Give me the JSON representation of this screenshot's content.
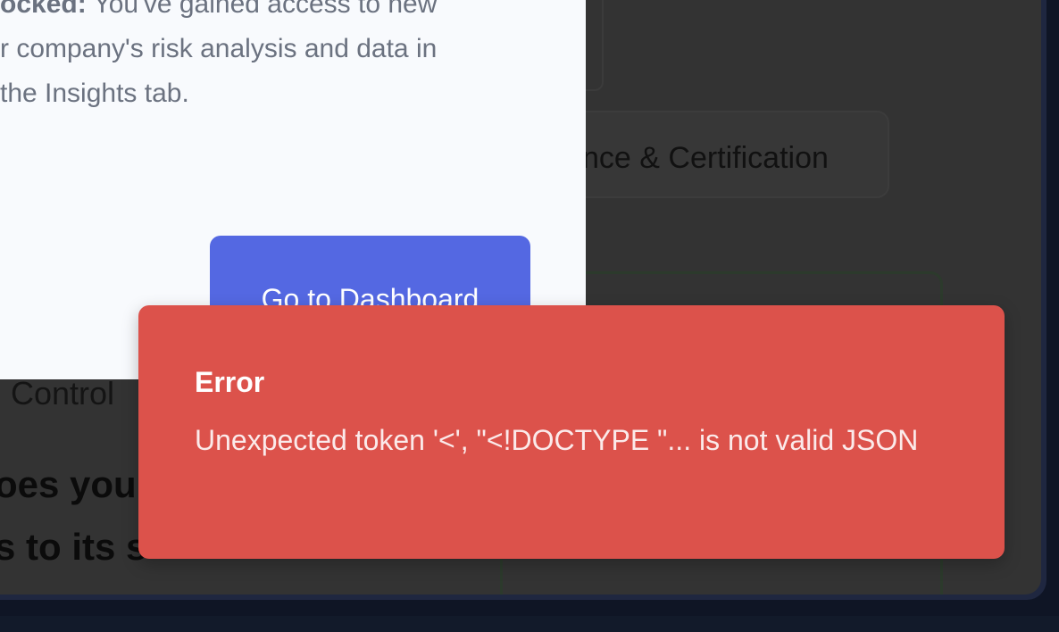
{
  "background": {
    "pill_label": "nce & Certification",
    "control_label": "Control",
    "question_line1": "oes you",
    "question_line2": "s to its s"
  },
  "modal": {
    "lead_bold": "ocked:",
    "text_line1_rest": " You've gained access to new",
    "text_line2": "r company's risk analysis and data in",
    "text_line3": "the Insights tab.",
    "button_label": "Go to Dashboard"
  },
  "toast": {
    "title": "Error",
    "message": "Unexpected token '<', \"<!DOCTYPE \"... is not valid JSON"
  },
  "colors": {
    "toast_bg": "#dc524b",
    "button_bg": "#5468e2",
    "modal_bg": "#f8fafd",
    "panel_bg": "#333333"
  }
}
